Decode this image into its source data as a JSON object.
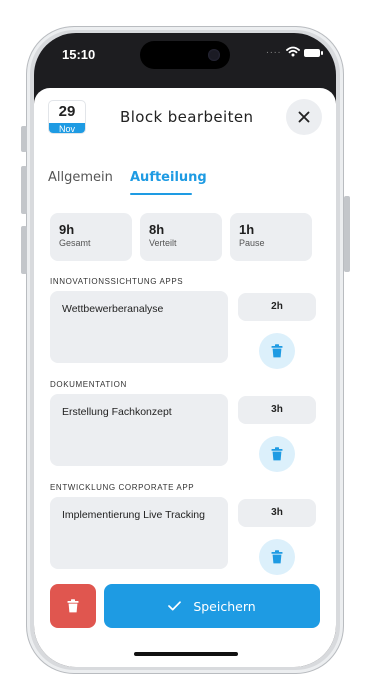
{
  "status_bar": {
    "time": "15:10",
    "signal_dots": "....",
    "wifi_icon": "wifi-icon",
    "battery_icon": "battery-icon"
  },
  "header": {
    "date": {
      "day": "29",
      "month": "Nov"
    },
    "title": "Block bearbeiten",
    "close_icon": "close-icon"
  },
  "tabs": [
    {
      "label": "Allgemein",
      "active": false
    },
    {
      "label": "Aufteilung",
      "active": true
    }
  ],
  "summary": [
    {
      "value": "9h",
      "label": "Gesamt"
    },
    {
      "value": "8h",
      "label": "Verteilt"
    },
    {
      "value": "1h",
      "label": "Pause"
    }
  ],
  "sections": [
    {
      "title": "INNOVATIONSSICHTUNG APPS",
      "task": "Wettbewerberanalyse",
      "hours": "2h"
    },
    {
      "title": "DOKUMENTATION",
      "task": "Erstellung Fachkonzept",
      "hours": "3h"
    },
    {
      "title": "ENTWICKLUNG CORPORATE APP",
      "task": "Implementierung Live Tracking",
      "hours": "3h"
    }
  ],
  "footer": {
    "save_label": "Speichern",
    "save_icon": "check-icon",
    "delete_icon": "trash-icon"
  },
  "colors": {
    "accent": "#1e9be3",
    "danger": "#e0564f",
    "card": "#eceef1",
    "icon_bg": "#dcf0fb"
  }
}
